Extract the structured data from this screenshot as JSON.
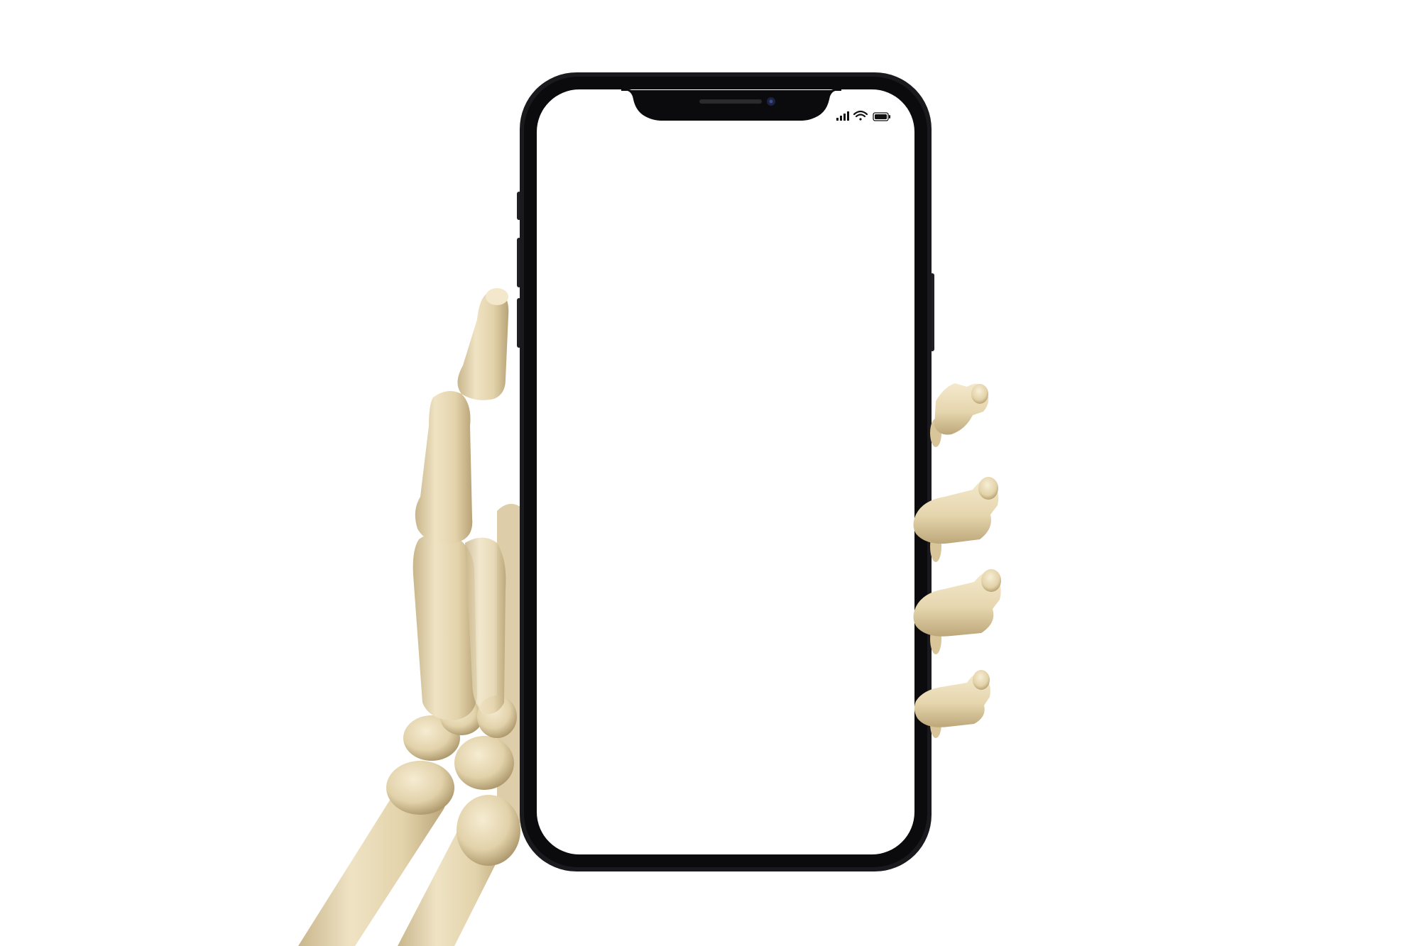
{
  "scene": {
    "background_color": "#ffffff",
    "subject": "skeleton-hand-holding-smartphone"
  },
  "phone": {
    "frame_color": "#16161a",
    "bezel_color": "#0b0b0d",
    "screen_color": "#ffffff",
    "screen_content": "blank",
    "status_bar": {
      "icons": [
        "signal-icon",
        "wifi-icon",
        "battery-icon"
      ]
    }
  },
  "bones": {
    "color": "#e8d9b5",
    "shadow_color": "#b49e72",
    "highlight_color": "#f6ecd2"
  }
}
